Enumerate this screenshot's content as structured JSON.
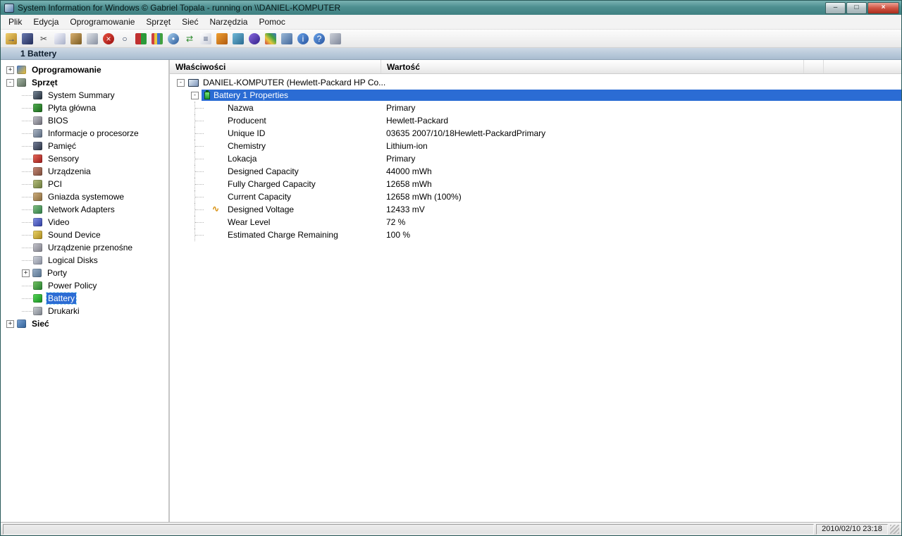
{
  "window": {
    "title": "System Information for Windows  © Gabriel Topala - running on \\\\DANIEL-KOMPUTER",
    "controls": [
      {
        "name": "minimize",
        "glyph": "–"
      },
      {
        "name": "maximize",
        "glyph": "□"
      },
      {
        "name": "close",
        "glyph": "×"
      }
    ]
  },
  "colors": {
    "titlebar": "#4e8f90",
    "selection": "#2b6cd4",
    "header_bar": "#a8bcd0"
  },
  "menu": {
    "items": [
      "Plik",
      "Edycja",
      "Oprogramowanie",
      "Sprzęt",
      "Sieć",
      "Narzędzia",
      "Pomoc"
    ]
  },
  "toolbar": {
    "icons": [
      {
        "name": "exit-icon",
        "c1": "#f0d070",
        "c2": "#b08020",
        "glyph": "→",
        "fg": "#1a3a8a"
      },
      {
        "name": "save-icon",
        "c1": "#6a7ab0",
        "c2": "#222c58"
      },
      {
        "name": "cut-icon",
        "glyph": "✂",
        "fg": "#444444"
      },
      {
        "name": "copy-icon",
        "c1": "#f8f8ff",
        "c2": "#a8b0c8"
      },
      {
        "name": "paste-icon",
        "c1": "#d8b070",
        "c2": "#7a5a20"
      },
      {
        "name": "print-icon",
        "c1": "#e0e4ea",
        "c2": "#8890a0"
      },
      {
        "name": "stop-icon",
        "c1": "#e85040",
        "c2": "#990f0f",
        "glyph": "×",
        "fg": "#ffffff",
        "round": true
      },
      {
        "name": "search-icon",
        "glyph": "○",
        "fg": "#223355"
      },
      {
        "name": "screen-icon",
        "bgcss": "linear-gradient(90deg,#c03030 50%,#2a9a3a 50%)"
      },
      {
        "name": "chart-icon",
        "bgcss": "linear-gradient(90deg,#d04040 25%,#e8c840 25%,#e8c840 50%,#4070d0 50%,#4070d0 75%,#40a040 75%)"
      },
      {
        "name": "cd-icon",
        "c1": "#a8d0f0",
        "c2": "#2a5a9a",
        "glyph": "•",
        "fg": "#ffffff",
        "round": true
      },
      {
        "name": "refresh-icon",
        "glyph": "⇄",
        "fg": "#2a8a2a"
      },
      {
        "name": "report-icon",
        "c1": "#ffffff",
        "c2": "#c8ccd8",
        "glyph": "≡",
        "fg": "#445577"
      },
      {
        "name": "tv-icon",
        "c1": "#f0a030",
        "c2": "#b05a10"
      },
      {
        "name": "document-icon",
        "c1": "#70b8d8",
        "c2": "#2a6a90"
      },
      {
        "name": "sphere-icon",
        "c1": "#8a6ae0",
        "c2": "#32208a",
        "round": true
      },
      {
        "name": "grid-icon",
        "bgcss": "linear-gradient(45deg,#d04040,#e8c840,#40a040,#4070d0)"
      },
      {
        "name": "database-icon",
        "c1": "#9ab8d8",
        "c2": "#44689a"
      },
      {
        "name": "info-icon",
        "c1": "#66a0e8",
        "c2": "#2a56a0",
        "glyph": "i",
        "fg": "#ffffff",
        "round": true
      },
      {
        "name": "help-icon",
        "c1": "#66a0e8",
        "c2": "#2a56a0",
        "glyph": "?",
        "fg": "#ffffff",
        "round": true
      },
      {
        "name": "printer2-icon",
        "c1": "#ccd0d8",
        "c2": "#80889a"
      }
    ]
  },
  "header": {
    "title": "1 Battery"
  },
  "sidebar": {
    "items": [
      {
        "label": "Oprogramowanie",
        "level": 0,
        "bold": true,
        "expander": "plus",
        "icon": {
          "name": "software-icon",
          "c1": "#4a7fd4",
          "c2": "#f0c030"
        }
      },
      {
        "label": "Sprzęt",
        "level": 0,
        "bold": true,
        "expander": "minus",
        "icon": {
          "name": "hardware-icon",
          "c1": "#a8b8a8",
          "c2": "#5a6a5a"
        }
      },
      {
        "label": "System Summary",
        "level": 1,
        "icon": {
          "name": "system-summary-icon",
          "c1": "#7a8a9a",
          "c2": "#222c38"
        }
      },
      {
        "label": "Płyta główna",
        "level": 1,
        "icon": {
          "name": "motherboard-icon",
          "c1": "#52b052",
          "c2": "#1a641a"
        }
      },
      {
        "label": "BIOS",
        "level": 1,
        "icon": {
          "name": "bios-icon",
          "c1": "#c4c4cc",
          "c2": "#6a6a74"
        }
      },
      {
        "label": "Informacje o procesorze",
        "level": 1,
        "icon": {
          "name": "cpu-icon",
          "c1": "#b0bac8",
          "c2": "#56667c"
        }
      },
      {
        "label": "Pamięć",
        "level": 1,
        "icon": {
          "name": "memory-icon",
          "c1": "#76809a",
          "c2": "#2a3242"
        }
      },
      {
        "label": "Sensory",
        "level": 1,
        "icon": {
          "name": "sensors-icon",
          "c1": "#e86a5a",
          "c2": "#9a1a1a"
        }
      },
      {
        "label": "Urządzenia",
        "level": 1,
        "icon": {
          "name": "devices-icon",
          "c1": "#c88a78",
          "c2": "#7a4a38"
        }
      },
      {
        "label": "PCI",
        "level": 1,
        "icon": {
          "name": "pci-icon",
          "c1": "#b8c07e",
          "c2": "#68783a"
        }
      },
      {
        "label": "Gniazda systemowe",
        "level": 1,
        "icon": {
          "name": "system-slots-icon",
          "c1": "#d0b080",
          "c2": "#86683a"
        }
      },
      {
        "label": "Network Adapters",
        "level": 1,
        "icon": {
          "name": "network-adapters-icon",
          "c1": "#84c284",
          "c2": "#2e7a46"
        }
      },
      {
        "label": "Video",
        "level": 1,
        "icon": {
          "name": "video-icon",
          "c1": "#8492e6",
          "c2": "#2e3ca0"
        }
      },
      {
        "label": "Sound Device",
        "level": 1,
        "icon": {
          "name": "sound-device-icon",
          "c1": "#ecd468",
          "c2": "#a8881c"
        }
      },
      {
        "label": "Urządzenie przenośne",
        "level": 1,
        "icon": {
          "name": "portable-device-icon",
          "c1": "#c6c6ce",
          "c2": "#7e7e88"
        }
      },
      {
        "label": "Logical Disks",
        "level": 1,
        "icon": {
          "name": "logical-disks-icon",
          "c1": "#d0d4dc",
          "c2": "#868c9c"
        }
      },
      {
        "label": "Porty",
        "level": 1,
        "expander": "plus",
        "icon": {
          "name": "ports-icon",
          "c1": "#9cb2ca",
          "c2": "#54708c"
        }
      },
      {
        "label": "Power Policy",
        "level": 1,
        "icon": {
          "name": "power-policy-icon",
          "c1": "#74c464",
          "c2": "#247c2e"
        }
      },
      {
        "label": "Battery",
        "level": 1,
        "selected": true,
        "icon": {
          "name": "battery-icon",
          "c1": "#58d858",
          "c2": "#168c20"
        }
      },
      {
        "label": "Drukarki",
        "level": 1,
        "icon": {
          "name": "printers-icon",
          "c1": "#ccd0d4",
          "c2": "#787e88"
        }
      },
      {
        "label": "Sieć",
        "level": 0,
        "bold": true,
        "expander": "plus",
        "icon": {
          "name": "network-icon",
          "c1": "#7ea6d6",
          "c2": "#2e5e96"
        }
      }
    ]
  },
  "main": {
    "columns": [
      "Właściwości",
      "Wartość"
    ],
    "tree": {
      "root": {
        "label": "DANIEL-KOMPUTER (Hewlett-Packard HP Co..."
      },
      "group": {
        "label": "Battery 1 Properties"
      },
      "rows": [
        {
          "property": "Nazwa",
          "value": "Primary"
        },
        {
          "property": "Producent",
          "value": "Hewlett-Packard"
        },
        {
          "property": "Unique ID",
          "value": "03635 2007/10/18Hewlett-PackardPrimary"
        },
        {
          "property": "Chemistry",
          "value": "Lithium-ion"
        },
        {
          "property": "Lokacja",
          "value": "Primary"
        },
        {
          "property": "Designed Capacity",
          "value": "44000 mWh"
        },
        {
          "property": "Fully Charged Capacity",
          "value": "12658 mWh"
        },
        {
          "property": "Current Capacity",
          "value": "12658 mWh (100%)"
        },
        {
          "property": "Designed Voltage",
          "value": "12433 mV",
          "icon": "voltage-icon"
        },
        {
          "property": "Wear Level",
          "value": "72 %"
        },
        {
          "property": "Estimated Charge Remaining",
          "value": "100 %"
        }
      ]
    }
  },
  "statusbar": {
    "datetime": "2010/02/10 23:18"
  }
}
